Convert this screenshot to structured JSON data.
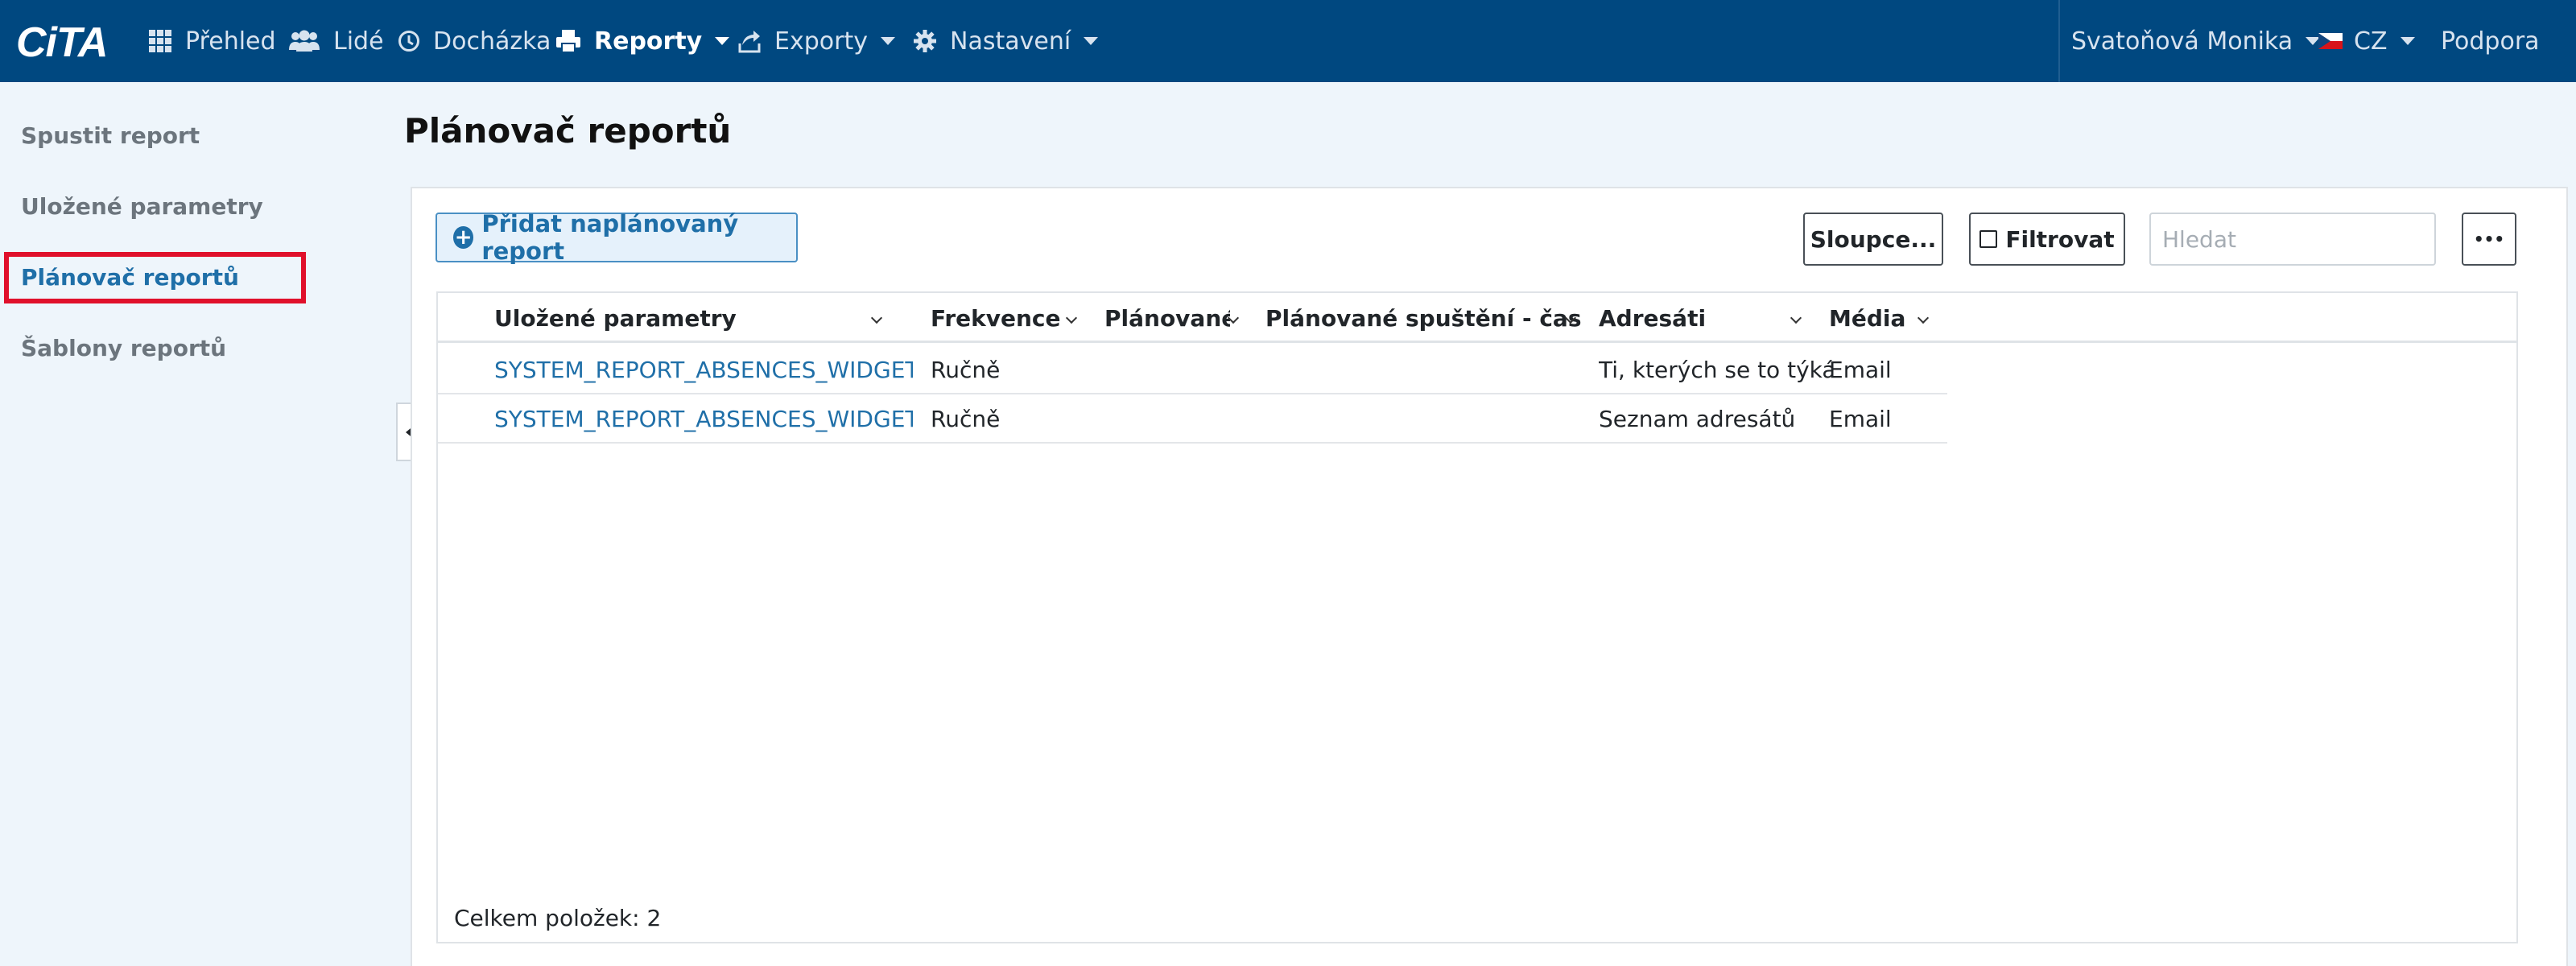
{
  "brand": {
    "logo_text": "CiTA"
  },
  "nav": {
    "overview": "Přehled",
    "people": "Lidé",
    "attendance": "Docházka",
    "reports": "Reporty",
    "exports": "Exporty",
    "settings": "Nastavení",
    "user": "Svatoňová Monika",
    "language": "CZ",
    "support": "Podpora"
  },
  "sidebar": {
    "items": [
      {
        "label": "Spustit report"
      },
      {
        "label": "Uložené parametry"
      },
      {
        "label": "Plánovač reportů"
      },
      {
        "label": "Šablony reportů"
      }
    ]
  },
  "main": {
    "title": "Plánovač reportů",
    "add_button": "Přidat naplánovaný report",
    "columns_button": "Sloupce...",
    "filter_button": "Filtrovat",
    "search_placeholder": "Hledat",
    "more_button": "•••"
  },
  "table": {
    "headers": [
      "Uložené parametry",
      "Frekvence ...",
      "Plánované ...",
      "Plánované spuštění - čas",
      "Adresáti",
      "Média"
    ],
    "rows": [
      [
        "SYSTEM_REPORT_ABSENCES_WIDGET...",
        "Ručně",
        "",
        "",
        "Ti, kterých se to týká",
        "Email"
      ],
      [
        "SYSTEM_REPORT_ABSENCES_WIDGET...",
        "Ručně",
        "",
        "",
        "Seznam adresátů",
        "Email"
      ]
    ],
    "total": "Celkem položek: 2"
  },
  "colors": {
    "navbar": "#004880",
    "accent": "#1f6fa8",
    "highlight": "#e0102b",
    "background": "#eef5fb"
  }
}
